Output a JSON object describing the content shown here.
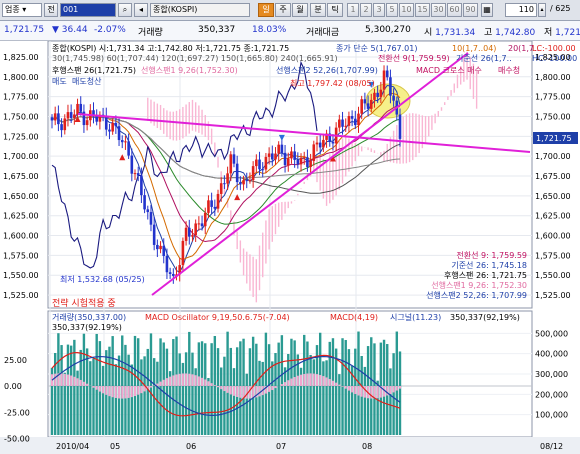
{
  "toolbar": {
    "market": "업종",
    "type_label": "전",
    "code": "001",
    "name": "종합(KOSPI)",
    "period_active": "일",
    "period_buttons": [
      "일",
      "주",
      "월",
      "분",
      "틱"
    ],
    "minute_steps": [
      "1",
      "2",
      "3",
      "5",
      "10",
      "15",
      "30",
      "60",
      "90"
    ],
    "count": "110",
    "total": "625"
  },
  "quote": {
    "price": "1,721.75",
    "change": "36.44",
    "change_pct": "-2.07%",
    "volume_label": "거래량",
    "volume": "350,337",
    "volume_ratio": "18.03%",
    "amount_label": "거래대금",
    "amount": "5,300,270",
    "open_label": "시",
    "open": "1,731.34",
    "high_label": "고",
    "high": "1,742.80",
    "low_label": "저",
    "low": "1,721.7"
  },
  "legend": {
    "line1": "종합(KOSPI) 시:1,731.34 고:1,742.80 저:1,721.75 종:1,721.75",
    "ma5": "종가 단순 5(1,767.01)",
    "ma10": "10(1,7..04)",
    "ma20": "20(1,7..",
    "line2_ma": "30(1,745.98)  60(1,707.44)  120(1,697.27)  150(1,665.80)  240(1,665.91)",
    "conv": "전환선 9(1,759.59)",
    "base": "기준선 26(1,7..",
    "lagging": "후행스팬 26(1,721.75)",
    "lead1": "선행스팬1 9,26(1,752.30)",
    "lead2": "선행스팬2 52,26(1,707.99)",
    "macd_cross": "MACD 크로스 매수",
    "buy_clear": "매수청",
    "sell": "매도",
    "sell_clear": "매도청산",
    "lc": "LC:-100.00",
    "hc": "HC:-100.00"
  },
  "annotations": {
    "high": "최고 1,797.42 (08/05)",
    "low": "최저 1,532.68 (05/25)",
    "strategy": "전략 시험적용 중",
    "box": [
      {
        "label": "전환선 9:",
        "value": "1,759.59"
      },
      {
        "label": "기준선 26:",
        "value": "1,745.18"
      },
      {
        "label": "후행스팬 26:",
        "value": "1,721.75"
      },
      {
        "label": "선행스팬1 9,26:",
        "value": "1,752.30"
      },
      {
        "label": "선행스팬2 52,26:",
        "value": "1,707.99"
      }
    ]
  },
  "price_axis": [
    "1,825.00",
    "1,800.00",
    "1,775.00",
    "1,750.00",
    "1,725.00",
    "1,700.00",
    "1,675.00",
    "1,650.00",
    "1,625.00",
    "1,600.00",
    "1,575.00",
    "1,550.00",
    "1,525.00"
  ],
  "last_price_tag": "1,721.75",
  "sub_legend": {
    "volume": "거래량(350,337.00)",
    "osc": "MACD Oscillator 9,19,50.6.75(-7.04)",
    "macd": "MACD(4,19)",
    "signal": "시그널(11.23)",
    "left_value": "350,337(92.19%)",
    "right_value": "350,337(92,19%)"
  },
  "vol_axis": [
    "500,000",
    "400,000",
    "300,000",
    "200,000",
    "100,000"
  ],
  "osc_axis": [
    "25.00",
    "0.00",
    "-25.00",
    "-50.00"
  ],
  "date_axis": [
    "2010/04",
    "05",
    "06",
    "07",
    "08"
  ],
  "date_future": "08/12",
  "colors": {
    "up": "#e0201b",
    "down": "#2233cc",
    "trend": "#e020d8",
    "highlight": "#f6f08a",
    "cloud": "#f9b6d3",
    "volume": "#2a9a92",
    "osc": "#f3a6cf"
  },
  "chart_data": {
    "type": "candlestick",
    "y_range": [
      1515,
      1835
    ],
    "dates": [
      "2010/04",
      "05",
      "06",
      "07",
      "08"
    ],
    "high": {
      "value": 1797.42,
      "date": "08/05"
    },
    "low": {
      "value": 1532.68,
      "date": "05/25"
    },
    "last": {
      "open": 1731.34,
      "high": 1742.8,
      "low": 1721.75,
      "close": 1721.75
    }
  }
}
